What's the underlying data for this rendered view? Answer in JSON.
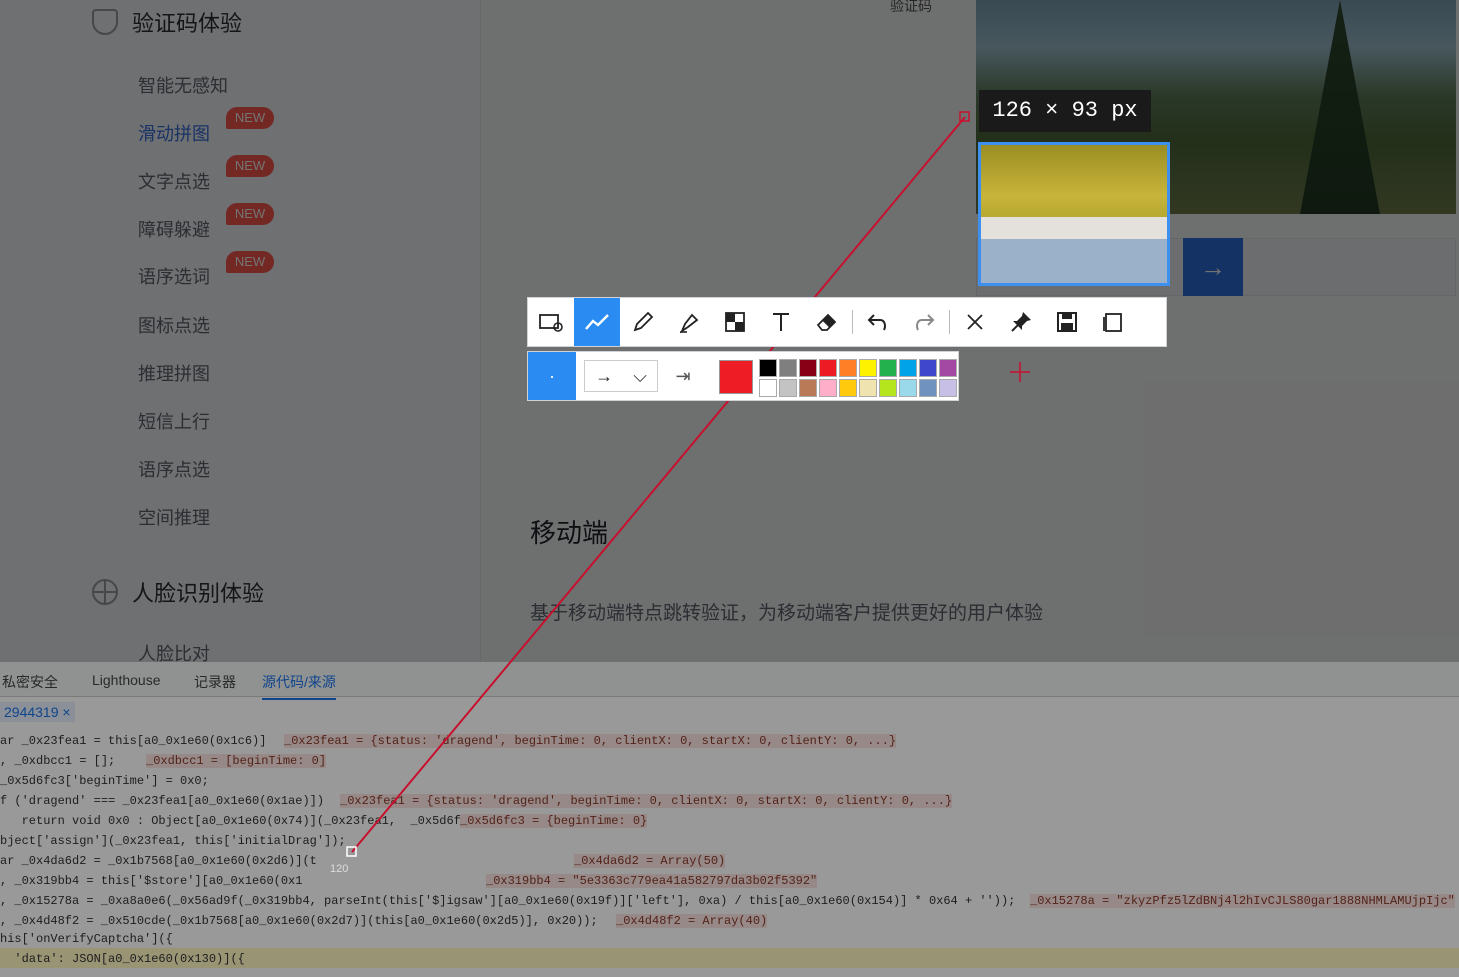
{
  "sidebar": {
    "section1_title": "验证码体验",
    "items": [
      {
        "label": "智能无感知",
        "badge": ""
      },
      {
        "label": "滑动拼图",
        "badge": "NEW"
      },
      {
        "label": "文字点选",
        "badge": "NEW"
      },
      {
        "label": "障碍躲避",
        "badge": "NEW"
      },
      {
        "label": "语序选词",
        "badge": "NEW"
      },
      {
        "label": "图标点选",
        "badge": ""
      },
      {
        "label": "推理拼图",
        "badge": ""
      },
      {
        "label": "短信上行",
        "badge": ""
      },
      {
        "label": "语序点选",
        "badge": ""
      },
      {
        "label": "空间推理",
        "badge": ""
      }
    ],
    "section2_title": "人脸识别体验",
    "section2_items": [
      "人脸比对"
    ]
  },
  "content": {
    "verify_label": "验证码",
    "mobile_heading": "移动端",
    "mobile_desc": "基于移动端特点跳转验证，为移动端客户提供更好的用户体验"
  },
  "captcha": {
    "slider_arrow": "→"
  },
  "screenshot_tool": {
    "size_tooltip": "126 × 93 px",
    "toolbar_icons": [
      "rectangle-icon",
      "polyline-icon",
      "pencil-icon",
      "marker-icon",
      "mosaic-icon",
      "text-icon",
      "eraser-icon",
      "undo-icon",
      "redo-icon",
      "close-icon",
      "pin-icon",
      "save-icon",
      "copy-icon"
    ],
    "active_tool": "polyline-icon",
    "pen_size_glyph": "·",
    "arrow_style_glyph": "→",
    "dropdown_glyph": "⌵",
    "arrow_option_glyph": "⇥",
    "current_color": "#ee1c24",
    "palette": [
      "#000000",
      "#7f7f7f",
      "#880015",
      "#ed1c24",
      "#ff7f27",
      "#fff200",
      "#22b14c",
      "#00a2e8",
      "#3f48cc",
      "#a349a4",
      "#ffffff",
      "#c3c3c3",
      "#b97a57",
      "#ffaec9",
      "#ffc90e",
      "#efe4b0",
      "#b5e61d",
      "#99d9ea",
      "#7092be",
      "#c8bfe7"
    ]
  },
  "devtools": {
    "tabs": [
      "私密安全",
      "Lighthouse",
      "记录器",
      "源代码/来源"
    ],
    "active_tab": "源代码/来源",
    "file_tab": "2944319 ×",
    "lines": [
      "ar _0x23fea1 = this[a0_0x1e60(0x1c6)]",
      ", _0xdbcc1 = [];",
      "_0x5d6fc3['beginTime'] = 0x0;",
      "f ('dragend' === _0x23fea1[a0_0x1e60(0x1ae)])",
      "   return void 0x0 : Object[a0_0x1e60(0x74)](_0x23fea1,  _0x5d6fc3);",
      "bject['assign'](_0x23fea1, this['initialDrag']);",
      "ar _0x4da6d2 = _0x1b7568[a0_0x1e60(0x2d6)](t",
      ", _0x319bb4 = this['$store'][a0_0x1e60(0x1",
      ", _0x15278a = _0xa8a0e6(_0x56ad9f(_0x319bb4, parseInt(this['$]igsaw'][a0_0x1e60(0x19f)]['left'], 0xa) / this[a0_0x1e60(0x154)] * 0x64 + ''));",
      ", _0x4d48f2 = _0x510cde(_0x1b7568[a0_0x1e60(0x2d7)](this[a0_0x1e60(0x2d5)], 0x20));",
      "his['onVerifyCaptcha']({",
      "  'data': JSON[a0_0x1e60(0x130)]({"
    ],
    "hints": [
      "_0x23fea1 = {status: 'dragend', beginTime: 0, clientX: 0, startX: 0, clientY: 0, ...}",
      "_0xdbcc1 = [beginTime: 0]",
      "_0x23fea1 = {status: 'dragend', beginTime: 0, clientX: 0, startX: 0, clientY: 0, ...}",
      "_0x5d6fc3 = {beginTime: 0}",
      "_0x4da6d2 = Array(50)",
      "_0x319bb4 = \"5e3363c779ea41a582797da3b02f5392\"",
      "_0x15278a = \"zkyzPfz5lZdBNj4l2hIvCJLS80gar1888NHMLAMUjpIjc\"",
      "_0x4d48f2 = Array(40)"
    ],
    "cursor_label": "120"
  }
}
